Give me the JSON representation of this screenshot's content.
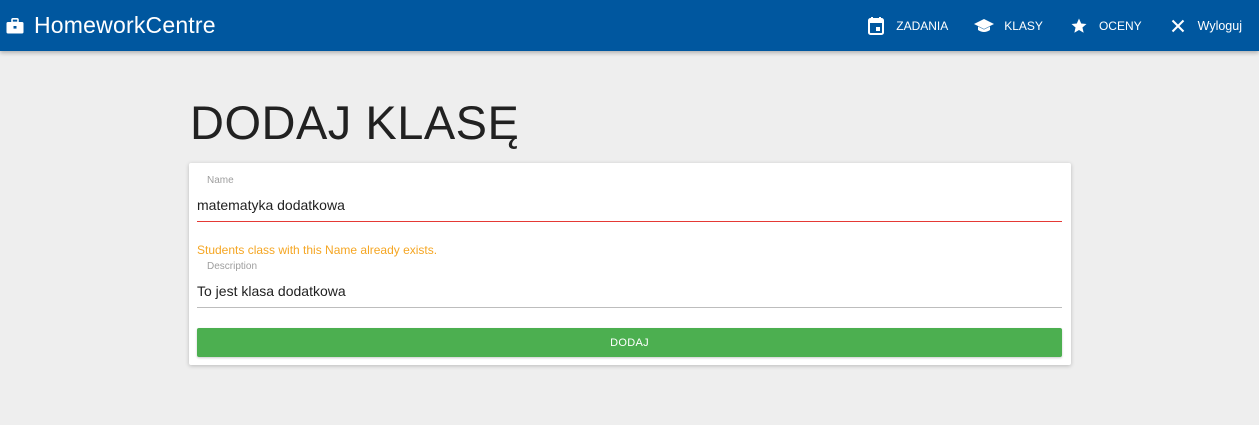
{
  "navbar": {
    "brand": {
      "label": "HomeworkCentre",
      "icon": "briefcase-icon"
    },
    "links": [
      {
        "label": "ZADANIA",
        "icon": "calendar-icon"
      },
      {
        "label": "KLASY",
        "icon": "graduation-cap-icon"
      },
      {
        "label": "OCENY",
        "icon": "star-icon"
      },
      {
        "label": "Wyloguj",
        "icon": "close-icon"
      }
    ],
    "background": "#00579f"
  },
  "page": {
    "title": "DODAJ KLASĘ"
  },
  "form": {
    "name": {
      "label": "Name",
      "value": "matematyka dodatkowa",
      "error": "Students class with this Name already exists.",
      "error_color": "#f5a623",
      "underline_color": "#e53935"
    },
    "description": {
      "label": "Description",
      "value": "To jest klasa dodatkowa"
    },
    "submit": {
      "label": "DODAJ",
      "color": "#4caf50"
    }
  }
}
